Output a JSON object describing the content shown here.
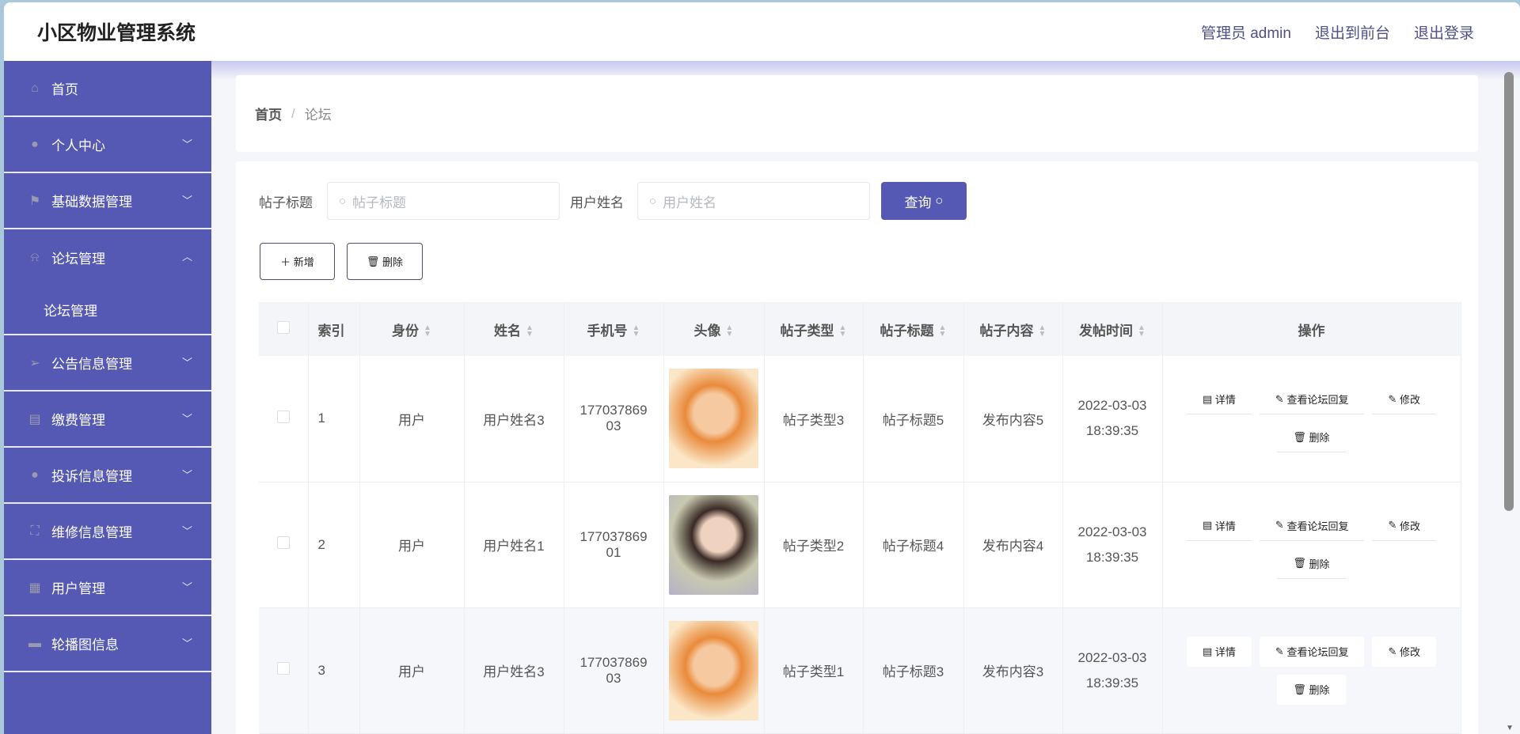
{
  "header": {
    "title": "小区物业管理系统",
    "user": "管理员 admin",
    "to_front": "退出到前台",
    "logout": "退出登录"
  },
  "sidebar": {
    "items": [
      {
        "label": "首页",
        "icon": "home-icon"
      },
      {
        "label": "个人中心",
        "icon": "user-icon"
      },
      {
        "label": "基础数据管理",
        "icon": "flag-icon"
      },
      {
        "label": "论坛管理",
        "icon": "bell-off-icon",
        "sub": "论坛管理"
      },
      {
        "label": "公告信息管理",
        "icon": "send-icon"
      },
      {
        "label": "缴费管理",
        "icon": "clipboard-icon"
      },
      {
        "label": "投诉信息管理",
        "icon": "bulb-icon"
      },
      {
        "label": "维修信息管理",
        "icon": "fullscreen-icon"
      },
      {
        "label": "用户管理",
        "icon": "grid-icon"
      },
      {
        "label": "轮播图信息",
        "icon": "monitor-icon"
      }
    ]
  },
  "breadcrumb": {
    "home": "首页",
    "sep": "/",
    "current": "论坛"
  },
  "search": {
    "title_label": "帖子标题",
    "title_placeholder": "帖子标题",
    "name_label": "用户姓名",
    "name_placeholder": "用户姓名",
    "query": "查询"
  },
  "actions": {
    "add": "新增",
    "delete": "删除"
  },
  "table": {
    "headers": [
      "索引",
      "身份",
      "姓名",
      "手机号",
      "头像",
      "帖子类型",
      "帖子标题",
      "帖子内容",
      "发帖时间",
      "操作"
    ],
    "ops": {
      "detail": "详情",
      "replies": "查看论坛回复",
      "edit": "修改",
      "delete": "删除"
    },
    "rows": [
      {
        "index": "1",
        "role": "用户",
        "name": "用户姓名3",
        "phone1": "177037869",
        "phone2": "03",
        "type": "帖子类型3",
        "title": "帖子标题5",
        "content": "发布内容5",
        "date": "2022-03-03",
        "time": "18:39:35"
      },
      {
        "index": "2",
        "role": "用户",
        "name": "用户姓名1",
        "phone1": "177037869",
        "phone2": "01",
        "type": "帖子类型2",
        "title": "帖子标题4",
        "content": "发布内容4",
        "date": "2022-03-03",
        "time": "18:39:35"
      },
      {
        "index": "3",
        "role": "用户",
        "name": "用户姓名3",
        "phone1": "177037869",
        "phone2": "03",
        "type": "帖子类型1",
        "title": "帖子标题3",
        "content": "发布内容3",
        "date": "2022-03-03",
        "time": "18:39:35"
      }
    ]
  }
}
